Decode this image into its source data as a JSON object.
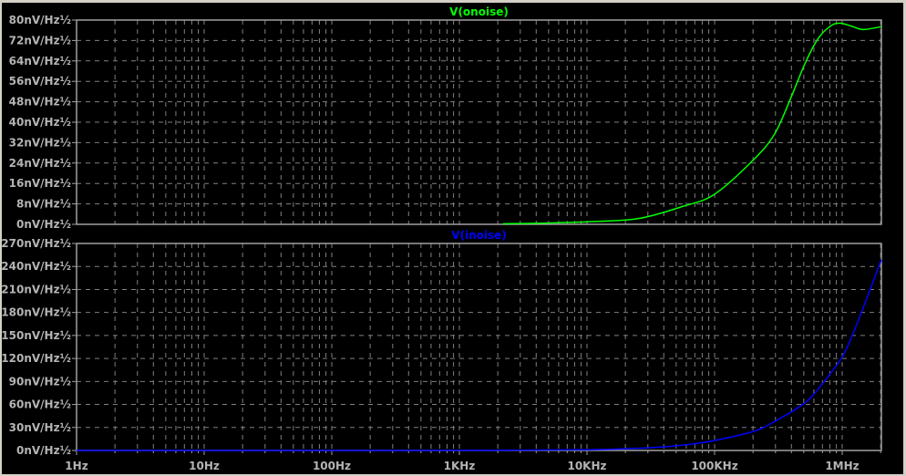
{
  "chart_data": [
    {
      "type": "line",
      "title": "V(onoise)",
      "xscale": "log",
      "xlim": [
        1,
        2030000
      ],
      "ylim": [
        0,
        80
      ],
      "yticks": [
        "0nV/Hz½",
        "8nV/Hz½",
        "16nV/Hz½",
        "24nV/Hz½",
        "32nV/Hz½",
        "40nV/Hz½",
        "48nV/Hz½",
        "56nV/Hz½",
        "64nV/Hz½",
        "72nV/Hz½",
        "80nV/Hz½"
      ],
      "color": "#00ff00",
      "grid": true,
      "series": [
        {
          "name": "V(onoise)",
          "x": [
            2200,
            5000,
            10000,
            25000,
            57000,
            100000,
            203000,
            296000,
            398000,
            510000,
            640000,
            795000,
            950000,
            1200000,
            1460000,
            2030000
          ],
          "y": [
            0.2,
            0.5,
            1,
            2.2,
            7.1,
            11.8,
            25.4,
            35.5,
            49.8,
            62.9,
            72.4,
            77.4,
            78.8,
            77.5,
            76.3,
            77.4
          ]
        }
      ]
    },
    {
      "type": "line",
      "title": "V(inoise)",
      "xscale": "log",
      "xlim": [
        1,
        2030000
      ],
      "ylim": [
        0,
        270
      ],
      "yticks": [
        "0nV/Hz½",
        "30nV/Hz½",
        "60nV/Hz½",
        "90nV/Hz½",
        "120nV/Hz½",
        "150nV/Hz½",
        "180nV/Hz½",
        "210nV/Hz½",
        "240nV/Hz½",
        "270nV/Hz½"
      ],
      "xticks": [
        "1Hz",
        "10Hz",
        "100Hz",
        "1KHz",
        "10KHz",
        "100KHz",
        "1MHz"
      ],
      "color": "#0000ff",
      "grid": true,
      "series": [
        {
          "name": "V(inoise)",
          "x": [
            1,
            100,
            1000,
            10000,
            30000,
            57000,
            100000,
            203000,
            296000,
            510000,
            707000,
            1000000,
            1240000,
            1530000,
            2030000
          ],
          "y": [
            0,
            0,
            0.1,
            1,
            3.5,
            7,
            13,
            25,
            38,
            62,
            88,
            122,
            156,
            195,
            249
          ]
        }
      ]
    }
  ]
}
